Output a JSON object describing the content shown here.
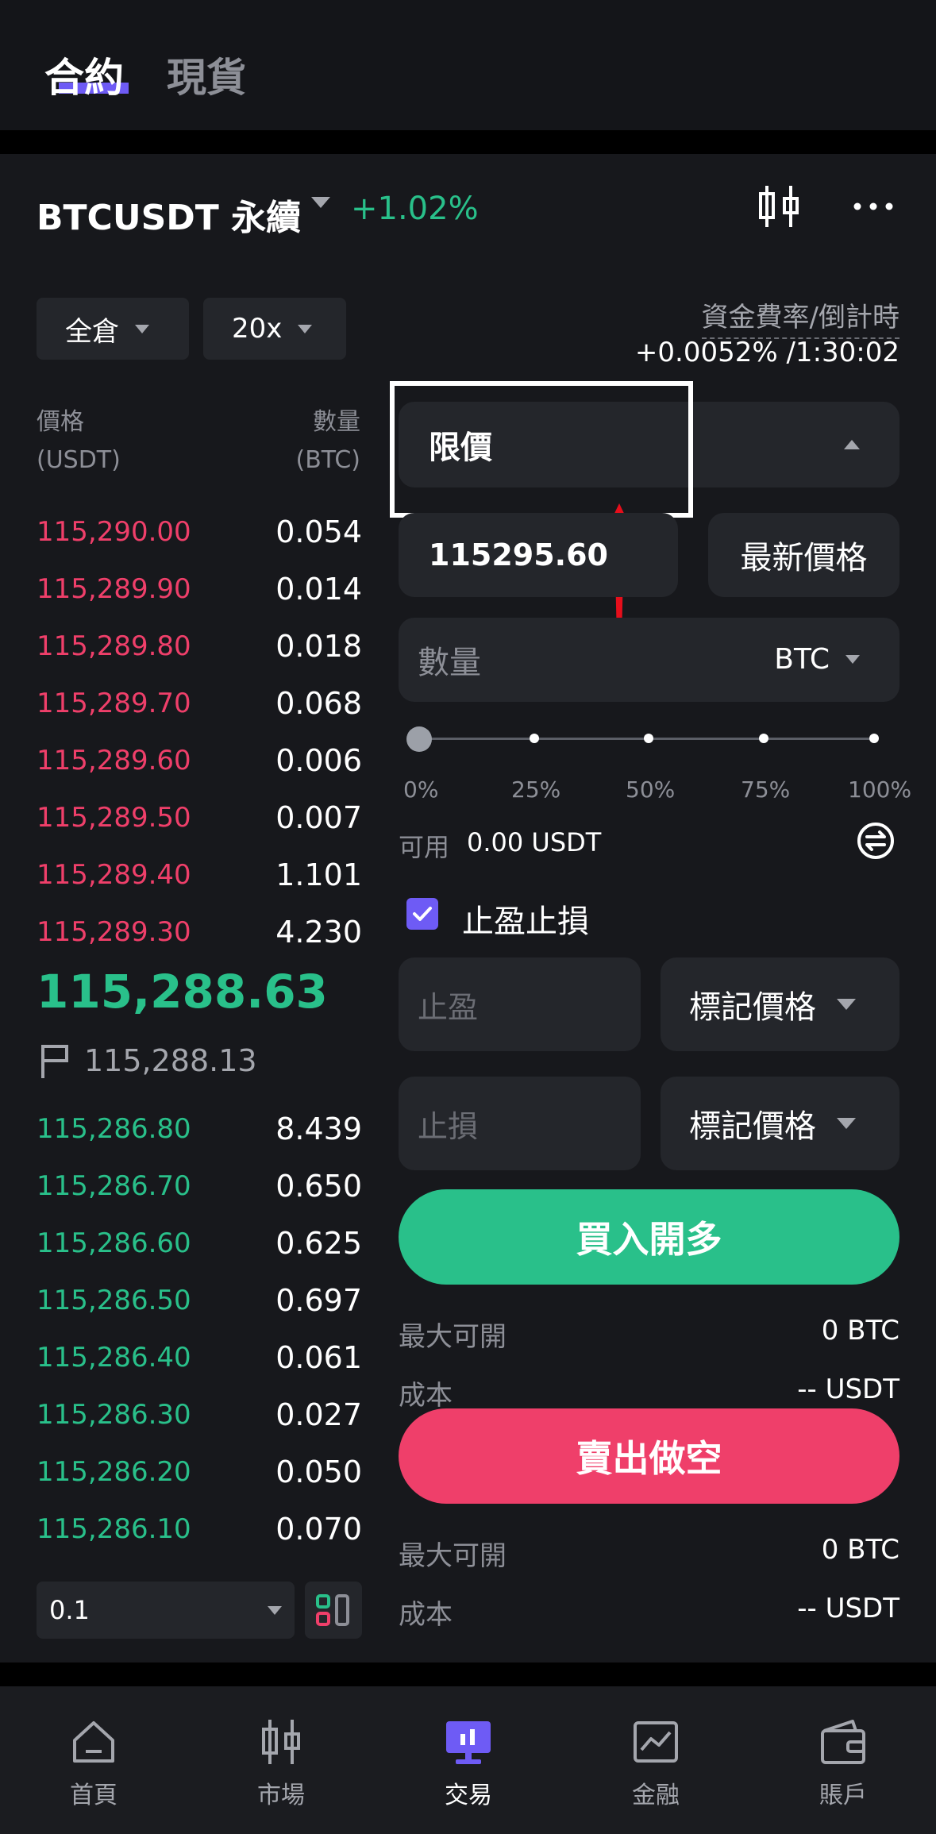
{
  "top_tabs": {
    "contract": "合約",
    "spot": "現貨"
  },
  "header": {
    "symbol": "BTCUSDT 永續",
    "change": "+1.02%"
  },
  "controls": {
    "margin_mode": "全倉",
    "leverage": "20x"
  },
  "funding": {
    "label": "資金費率/倒計時",
    "value": "+0.0052% /1:30:02"
  },
  "orderbook": {
    "price_header": "價格",
    "price_unit": "(USDT)",
    "qty_header": "數量",
    "qty_unit": "(BTC)",
    "asks": [
      {
        "price": "115,290.00",
        "qty": "0.054"
      },
      {
        "price": "115,289.90",
        "qty": "0.014"
      },
      {
        "price": "115,289.80",
        "qty": "0.018"
      },
      {
        "price": "115,289.70",
        "qty": "0.068"
      },
      {
        "price": "115,289.60",
        "qty": "0.006"
      },
      {
        "price": "115,289.50",
        "qty": "0.007"
      },
      {
        "price": "115,289.40",
        "qty": "1.101"
      },
      {
        "price": "115,289.30",
        "qty": "4.230"
      }
    ],
    "last_price": "115,288.63",
    "mark_price": "115,288.13",
    "bids": [
      {
        "price": "115,286.80",
        "qty": "8.439"
      },
      {
        "price": "115,286.70",
        "qty": "0.650"
      },
      {
        "price": "115,286.60",
        "qty": "0.625"
      },
      {
        "price": "115,286.50",
        "qty": "0.697"
      },
      {
        "price": "115,286.40",
        "qty": "0.061"
      },
      {
        "price": "115,286.30",
        "qty": "0.027"
      },
      {
        "price": "115,286.20",
        "qty": "0.050"
      },
      {
        "price": "115,286.10",
        "qty": "0.070"
      }
    ],
    "precision": "0.1"
  },
  "order_form": {
    "order_type": "限價",
    "price_value": "115295.60",
    "latest_price_btn": "最新價格",
    "qty_placeholder": "數量",
    "qty_unit": "BTC",
    "slider": {
      "value_pct": 0,
      "marks": [
        "0%",
        "25%",
        "50%",
        "75%",
        "100%"
      ]
    },
    "available_label": "可用",
    "available_value": "0.00 USDT",
    "tpsl_label": "止盈止損",
    "tpsl_checked": true,
    "tp_placeholder": "止盈",
    "sl_placeholder": "止損",
    "tp_trigger": "標記價格",
    "sl_trigger": "標記價格",
    "buy_label": "買入開多",
    "sell_label": "賣出做空",
    "buy_info": {
      "max_label": "最大可開",
      "max_value": "0 BTC",
      "cost_label": "成本",
      "cost_value": "-- USDT"
    },
    "sell_info": {
      "max_label": "最大可開",
      "max_value": "0 BTC",
      "cost_label": "成本",
      "cost_value": "-- USDT"
    }
  },
  "bottom_nav": [
    {
      "label": "首頁",
      "icon": "home-icon"
    },
    {
      "label": "市場",
      "icon": "candlestick-icon"
    },
    {
      "label": "交易",
      "icon": "trade-icon",
      "active": true
    },
    {
      "label": "金融",
      "icon": "finance-chart-icon"
    },
    {
      "label": "賬戶",
      "icon": "wallet-icon"
    }
  ],
  "colors": {
    "green": "#29c08a",
    "red": "#ef3f6a",
    "accent": "#6e5bf5"
  }
}
